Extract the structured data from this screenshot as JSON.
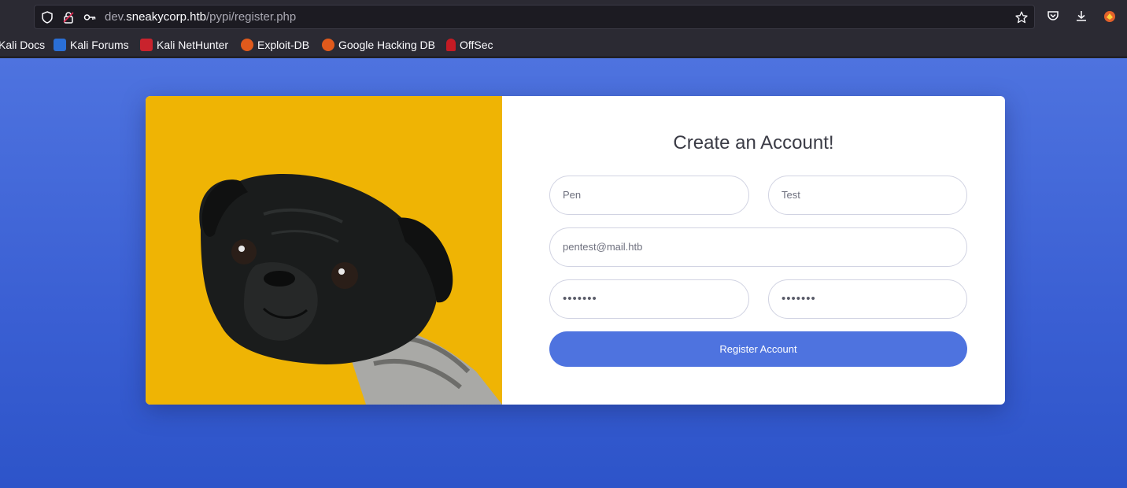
{
  "browser": {
    "url_prefix": "dev.",
    "url_host": "sneakycorp.htb",
    "url_path": "/pypi/register.php",
    "bookmarks": [
      {
        "label": "Kali Docs",
        "icon": "kali-docs-icon"
      },
      {
        "label": "Kali Forums",
        "icon": "kali-forums-icon"
      },
      {
        "label": "Kali NetHunter",
        "icon": "kali-nethunter-icon"
      },
      {
        "label": "Exploit-DB",
        "icon": "exploit-db-icon"
      },
      {
        "label": "Google Hacking DB",
        "icon": "google-hacking-db-icon"
      },
      {
        "label": "OffSec",
        "icon": "offsec-icon"
      }
    ]
  },
  "form": {
    "title": "Create an Account!",
    "first_name": "Pen",
    "last_name": "Test",
    "email": "pentest@mail.htb",
    "password": "•••••••",
    "repeat_password": "•••••••",
    "submit_label": "Register Account"
  },
  "colors": {
    "primary": "#4e73df",
    "photo_background": "#efb404"
  }
}
